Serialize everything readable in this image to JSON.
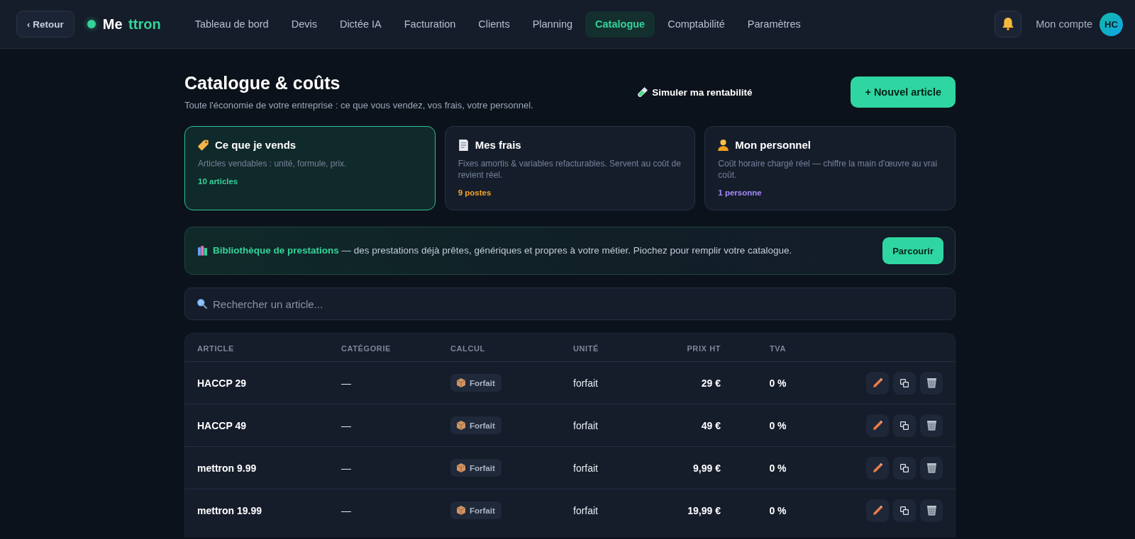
{
  "topbar": {
    "back_button": "‹ Retour",
    "logo": {
      "text": "Me",
      "accent": "ttron"
    },
    "nav": [
      {
        "label": "Tableau de bord",
        "selected": false
      },
      {
        "label": "Devis",
        "selected": false
      },
      {
        "label": "Dictée IA",
        "selected": false
      },
      {
        "label": "Facturation",
        "selected": false
      },
      {
        "label": "Clients",
        "selected": false
      },
      {
        "label": "Planning",
        "selected": false
      },
      {
        "label": "Catalogue",
        "selected": true
      },
      {
        "label": "Comptabilité",
        "selected": false
      },
      {
        "label": "Paramètres",
        "selected": false
      }
    ],
    "account": {
      "label": "Mon compte",
      "initials": "HC"
    }
  },
  "heading": {
    "title": "Catalogue & coûts",
    "subtitle": "Toute l'économie de votre entreprise : ce que vous vendez, vos frais, votre personnel.",
    "actions": [
      {
        "kind": "ghost",
        "label": "Simuler ma rentabilité"
      },
      {
        "kind": "primary",
        "label": "+ Nouvel article"
      }
    ]
  },
  "sections": [
    {
      "kind": "sales",
      "title": "Ce que je vends",
      "description": "Articles vendables : unité, formule, prix.",
      "count": "10 articles",
      "color": "#34d399",
      "selected": true
    },
    {
      "kind": "expenses",
      "title": "Mes frais",
      "description": "Fixes amortis & variables refacturables. Servent au coût de revient réel.",
      "count": "9 postes",
      "color": "#f5a524",
      "selected": false
    },
    {
      "kind": "staff",
      "title": "Mon personnel",
      "description": "Coût horaire chargé réel — chiffre la main d'œuvre au vrai coût.",
      "count": "1 personne",
      "color": "#a78bfa",
      "selected": false
    }
  ],
  "library": {
    "text": "**Bibliothèque de prestations** — des prestations déjà prêtes, génériques et propres à votre métier. Piochez pour remplir votre catalogue.",
    "button": "Parcourir"
  },
  "search": {
    "placeholder": "Rechercher un article..."
  },
  "table": {
    "columns": [
      "ARTICLE",
      "CATÉGORIE",
      "CALCUL",
      "UNITÉ",
      "PRIX HT",
      "TVA"
    ],
    "rows": [
      {
        "article": "HACCP 29",
        "category": "—",
        "calculation": "Forfait",
        "unit": "forfait",
        "price": "29 €",
        "vat": "0 %"
      },
      {
        "article": "HACCP 49",
        "category": "—",
        "calculation": "Forfait",
        "unit": "forfait",
        "price": "49 €",
        "vat": "0 %"
      },
      {
        "article": "mettron 9.99",
        "category": "—",
        "calculation": "Forfait",
        "unit": "forfait",
        "price": "9,99 €",
        "vat": "0 %"
      },
      {
        "article": "mettron 19.99",
        "category": "—",
        "calculation": "Forfait",
        "unit": "forfait",
        "price": "19,99 €",
        "vat": "0 %"
      }
    ]
  }
}
